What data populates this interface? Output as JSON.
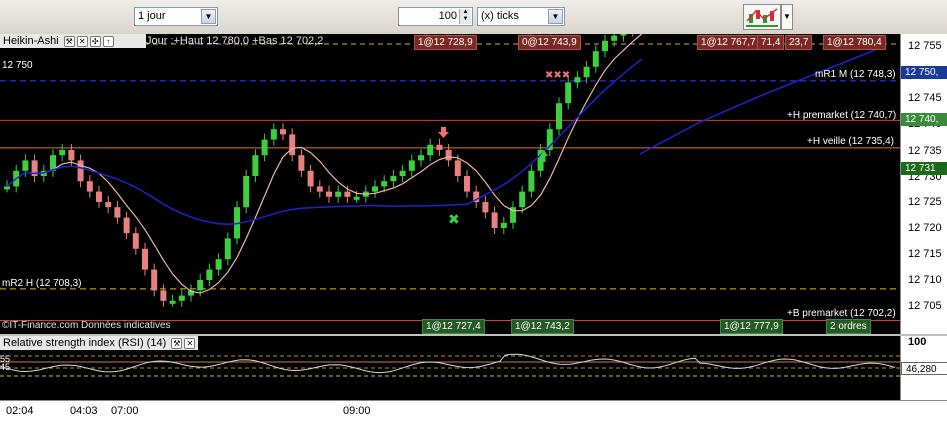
{
  "toolbar": {
    "period": "1 jour",
    "units": "100",
    "units_type": "(x) ticks"
  },
  "chart": {
    "instrument": "Heikin-Ashi",
    "day_info": "Jour :+Haut 12 780,0 +Bas 12 702,2",
    "level_left": "12 750",
    "source": "©IT-Finance.com Données indicatives",
    "top_tags": [
      "1@12 728,9",
      "0@12 743,9",
      "1@12 767,7",
      "71,4",
      "23,7",
      "1@12 780,4"
    ],
    "bottom_tags": [
      "1@12 727,4",
      "1@12 743,2",
      "1@12 777,9",
      "2 ordres"
    ],
    "levels": [
      {
        "label": "mR1 M (12 748,3)",
        "price": 12748.3,
        "color": "#3a3aff"
      },
      {
        "label": "+H premarket (12 740,7)",
        "price": 12740.7,
        "color": "#d04030"
      },
      {
        "label": "+H veille (12 735,4)",
        "price": 12735.4,
        "color": "#e07a20"
      },
      {
        "label": "mR2 H (12 708,3)",
        "price": 12708.3,
        "color": "#d8c020"
      },
      {
        "label": "+B premarket (12 702,2)",
        "price": 12702.2,
        "color": "#d04030"
      }
    ],
    "y_ticks": [
      "12 755",
      "12 745",
      "12 740",
      "12 735",
      "12 730",
      "12 725",
      "12 720",
      "12 715",
      "12 710",
      "12 705"
    ],
    "price_tags": [
      {
        "text": "12 750,",
        "color": "#1a3a9a"
      },
      {
        "text": "12 740,",
        "color": "#3a8a3a"
      },
      {
        "text": "12 731",
        "color": "#1a6a1a"
      }
    ]
  },
  "rsi": {
    "title": "Relative strength index (RSI) (14)",
    "left_labels": [
      "55",
      "45"
    ],
    "axis_top": "100",
    "current": "46,280"
  },
  "xaxis": {
    "labels": [
      "02:04",
      "04:03",
      "07:00",
      "09:00"
    ]
  },
  "colors": {
    "up": "#3ecf3e",
    "down": "#e88080",
    "ma_fast": "#e8b8a8",
    "ma_slow": "#2020d0",
    "rsi_line": "#d8d8d8"
  }
}
